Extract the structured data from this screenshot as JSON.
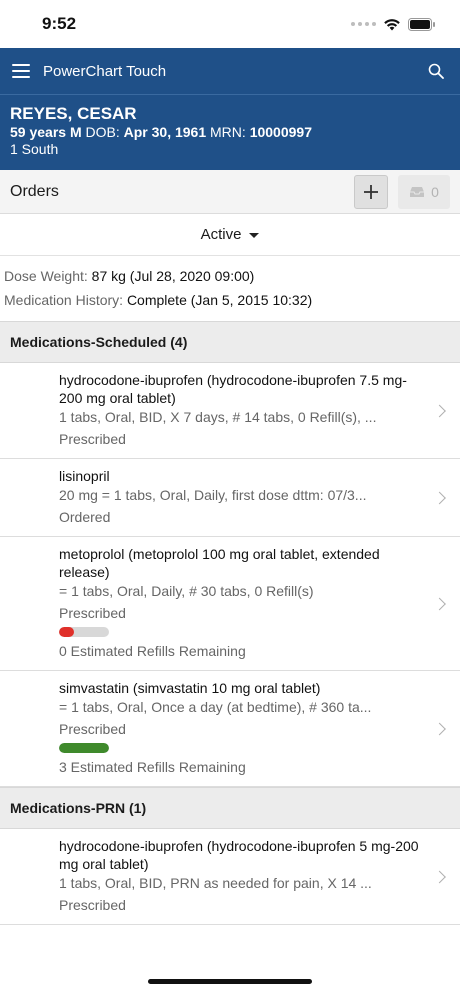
{
  "status_bar": {
    "time": "9:52"
  },
  "app_bar": {
    "title": "PowerChart Touch"
  },
  "patient": {
    "name": "REYES, CESAR",
    "age_sex": "59 years M",
    "dob_label": "DOB:",
    "dob": "Apr 30, 1961",
    "mrn_label": "MRN:",
    "mrn": "10000997",
    "location": "1 South"
  },
  "orders_bar": {
    "label": "Orders",
    "inbox_count": "0"
  },
  "filter": {
    "label": "Active"
  },
  "meta": {
    "dose_weight_label": "Dose Weight:",
    "dose_weight_value": "87 kg (Jul 28, 2020 09:00)",
    "med_history_label": "Medication History:",
    "med_history_value": "Complete (Jan 5, 2015 10:32)"
  },
  "sections": [
    {
      "title": "Medications-Scheduled (4)",
      "items": [
        {
          "title": "hydrocodone-ibuprofen (hydrocodone-ibuprofen 7.5 mg-200 mg oral tablet)",
          "detail": "1 tabs, Oral, BID, X 7 days, # 14 tabs, 0 Refill(s), ...",
          "status": "Prescribed"
        },
        {
          "title": "lisinopril",
          "detail": "20 mg = 1 tabs, Oral, Daily, first dose dttm: 07/3...",
          "status": "Ordered"
        },
        {
          "title": "metoprolol (metoprolol 100 mg oral tablet, extended release)",
          "detail": "= 1 tabs, Oral, Daily, # 30 tabs, 0 Refill(s)",
          "status": "Prescribed",
          "refill_fraction": 0.3,
          "refill_color": "#e0302a",
          "refill_text": "0 Estimated Refills Remaining"
        },
        {
          "title": "simvastatin (simvastatin 10 mg oral tablet)",
          "detail": "= 1 tabs, Oral, Once a day (at bedtime), # 360 ta...",
          "status": "Prescribed",
          "refill_fraction": 1.0,
          "refill_color": "#3f8a2c",
          "refill_text": "3 Estimated Refills Remaining"
        }
      ]
    },
    {
      "title": "Medications-PRN (1)",
      "items": [
        {
          "title": "hydrocodone-ibuprofen (hydrocodone-ibuprofen 5 mg-200 mg oral tablet)",
          "detail": "1 tabs, Oral, BID, PRN as needed for pain, X 14 ...",
          "status": "Prescribed"
        }
      ]
    }
  ],
  "colors": {
    "header_blue": "#1f5088",
    "refill_low": "#e0302a",
    "refill_ok": "#3f8a2c"
  }
}
